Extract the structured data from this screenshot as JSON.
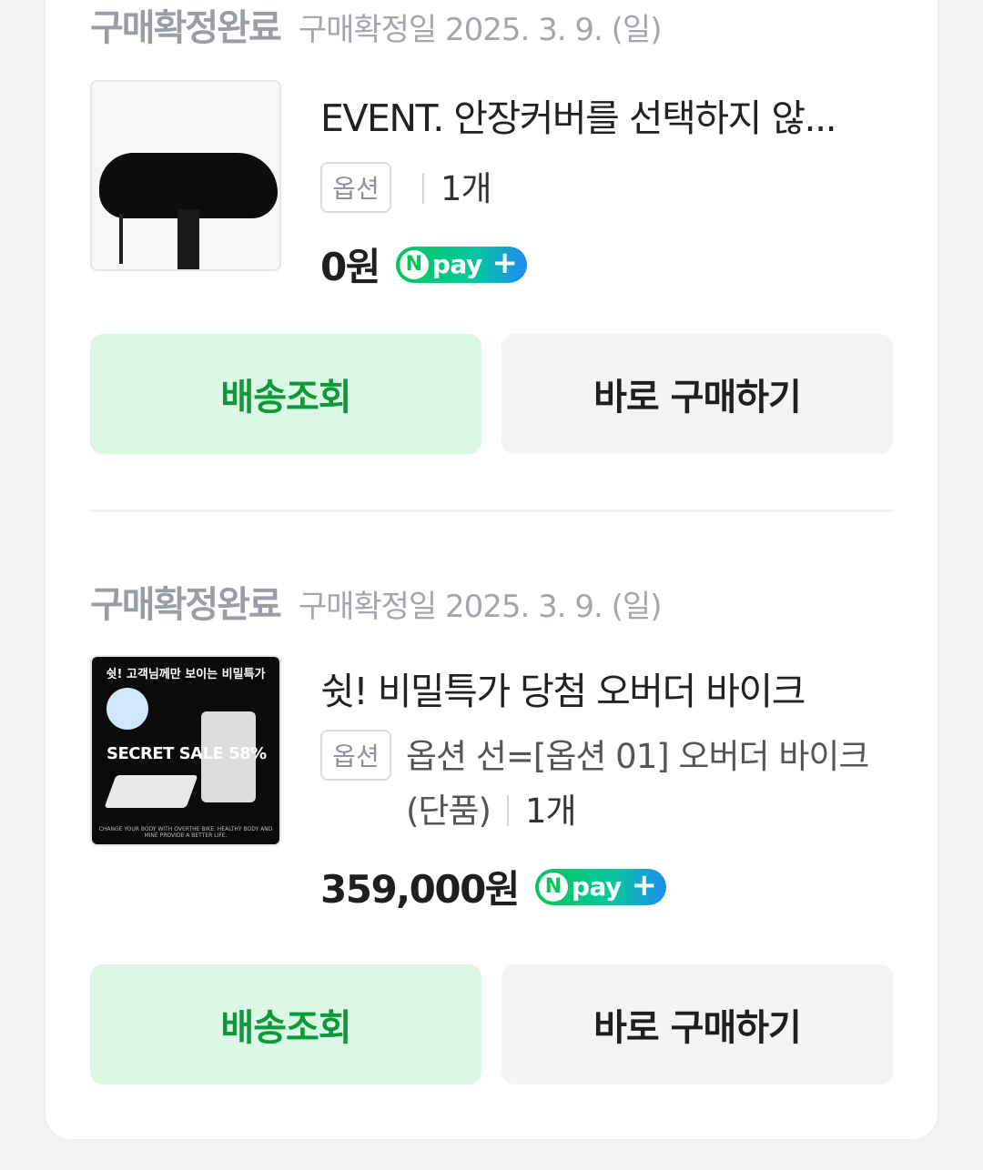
{
  "orders": [
    {
      "status": "구매확정완료",
      "confirm_date": "구매확정일 2025. 3. 9. (일)",
      "product_name": "EVENT. 안장커버를 선택하지 않...",
      "option_label": "옵션",
      "option_text": "",
      "quantity": "1개",
      "price": "0원",
      "npay_n": "N",
      "npay_text": "pay",
      "npay_plus": "+",
      "btn_track": "배송조회",
      "btn_buy": "바로 구매하기"
    },
    {
      "status": "구매확정완료",
      "confirm_date": "구매확정일 2025. 3. 9. (일)",
      "product_name": "쉿! 비밀특가 당첨 오버더 바이크",
      "option_label": "옵션",
      "option_text": "옵션 선=[옵션 01] 오버더 바이크 (단품)",
      "quantity": "1개",
      "price": "359,000원",
      "npay_n": "N",
      "npay_text": "pay",
      "npay_plus": "+",
      "btn_track": "배송조회",
      "btn_buy": "바로 구매하기",
      "thumb": {
        "title": "쉿! 고객님께만 보이는 비밀특가",
        "sale": "SECRET SALE 58%",
        "footer": "CHANGE YOUR BODY WITH OVERTHE BIKE. HEALTHY BODY AND MINE PROVIDE A BETTER LIFE."
      }
    }
  ],
  "colors": {
    "track_bg": "#dcf7e3",
    "track_text": "#0b9a3a",
    "buy_bg": "#f2f4f6",
    "status_text": "#9a9ea4"
  }
}
